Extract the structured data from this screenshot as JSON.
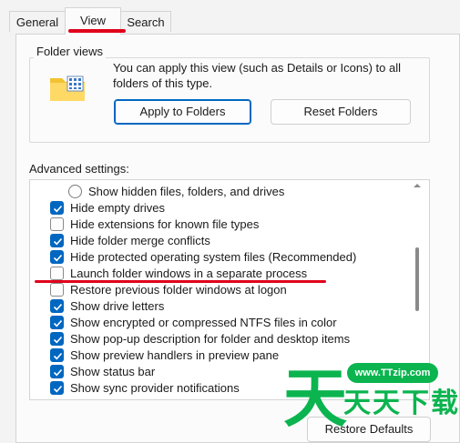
{
  "tabs": [
    {
      "label": "General",
      "active": false
    },
    {
      "label": "View",
      "active": true
    },
    {
      "label": "Search",
      "active": false
    }
  ],
  "folder_views": {
    "legend": "Folder views",
    "description": "You can apply this view (such as Details or Icons) to all folders of this type.",
    "apply_button": "Apply to Folders",
    "reset_button": "Reset Folders"
  },
  "advanced": {
    "label": "Advanced settings:",
    "items": [
      {
        "label": "Show hidden files, folders, and drives",
        "kind": "radio",
        "checked": false
      },
      {
        "label": "Hide empty drives",
        "kind": "checkbox",
        "checked": true
      },
      {
        "label": "Hide extensions for known file types",
        "kind": "checkbox",
        "checked": false
      },
      {
        "label": "Hide folder merge conflicts",
        "kind": "checkbox",
        "checked": true
      },
      {
        "label": "Hide protected operating system files (Recommended)",
        "kind": "checkbox",
        "checked": true
      },
      {
        "label": "Launch folder windows in a separate process",
        "kind": "checkbox",
        "checked": false
      },
      {
        "label": "Restore previous folder windows at logon",
        "kind": "checkbox",
        "checked": false
      },
      {
        "label": "Show drive letters",
        "kind": "checkbox",
        "checked": true
      },
      {
        "label": "Show encrypted or compressed NTFS files in color",
        "kind": "checkbox",
        "checked": true
      },
      {
        "label": "Show pop-up description for folder and desktop items",
        "kind": "checkbox",
        "checked": true
      },
      {
        "label": "Show preview handlers in preview pane",
        "kind": "checkbox",
        "checked": true
      },
      {
        "label": "Show status bar",
        "kind": "checkbox",
        "checked": true
      },
      {
        "label": "Show sync provider notifications",
        "kind": "checkbox",
        "checked": true
      }
    ]
  },
  "restore_defaults_button": "Restore Defaults",
  "watermark": {
    "logo": "天",
    "url": "www.TTzip.com",
    "text": "天天下载"
  },
  "colors": {
    "accent": "#0067c0",
    "annotation": "#e0001b",
    "watermark": "#0bb44f"
  }
}
